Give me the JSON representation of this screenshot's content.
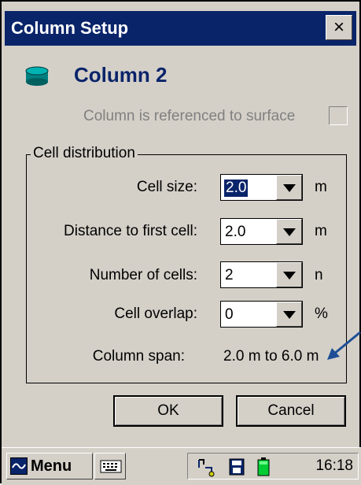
{
  "window": {
    "title": "Column Setup",
    "close_label": "×"
  },
  "column": {
    "name": "Column 2"
  },
  "reference": {
    "label": "Column is referenced to surface",
    "checked": false
  },
  "cell_distribution": {
    "title": "Cell distribution",
    "fields": [
      {
        "label": "Cell size:",
        "value": "2.0",
        "unit": "m"
      },
      {
        "label": "Distance to first cell:",
        "value": "2.0",
        "unit": "m"
      },
      {
        "label": "Number of cells:",
        "value": "2",
        "unit": "n"
      },
      {
        "label": "Cell overlap:",
        "value": "0",
        "unit": "%"
      }
    ],
    "span": {
      "label": "Column span:",
      "value": "2.0 m to 6.0 m"
    }
  },
  "buttons": {
    "ok": "OK",
    "cancel": "Cancel"
  },
  "taskbar": {
    "menu_label": "Menu",
    "clock": "16:18"
  },
  "icons": {
    "column": "cylinder-icon",
    "close": "close-icon",
    "dropdown": "chevron-down-icon",
    "annotation": "arrow-icon",
    "menu": "start-menu-icon",
    "keyboard": "keyboard-icon",
    "tray": [
      "connectivity-icon",
      "storage-card-icon",
      "battery-icon"
    ]
  },
  "colors": {
    "title_bar": "#0a246a",
    "column_name": "#0a246a",
    "dialog_face": "#d4d0c8",
    "annotation_arrow": "#1f4e96",
    "battery": "#00cc33"
  }
}
